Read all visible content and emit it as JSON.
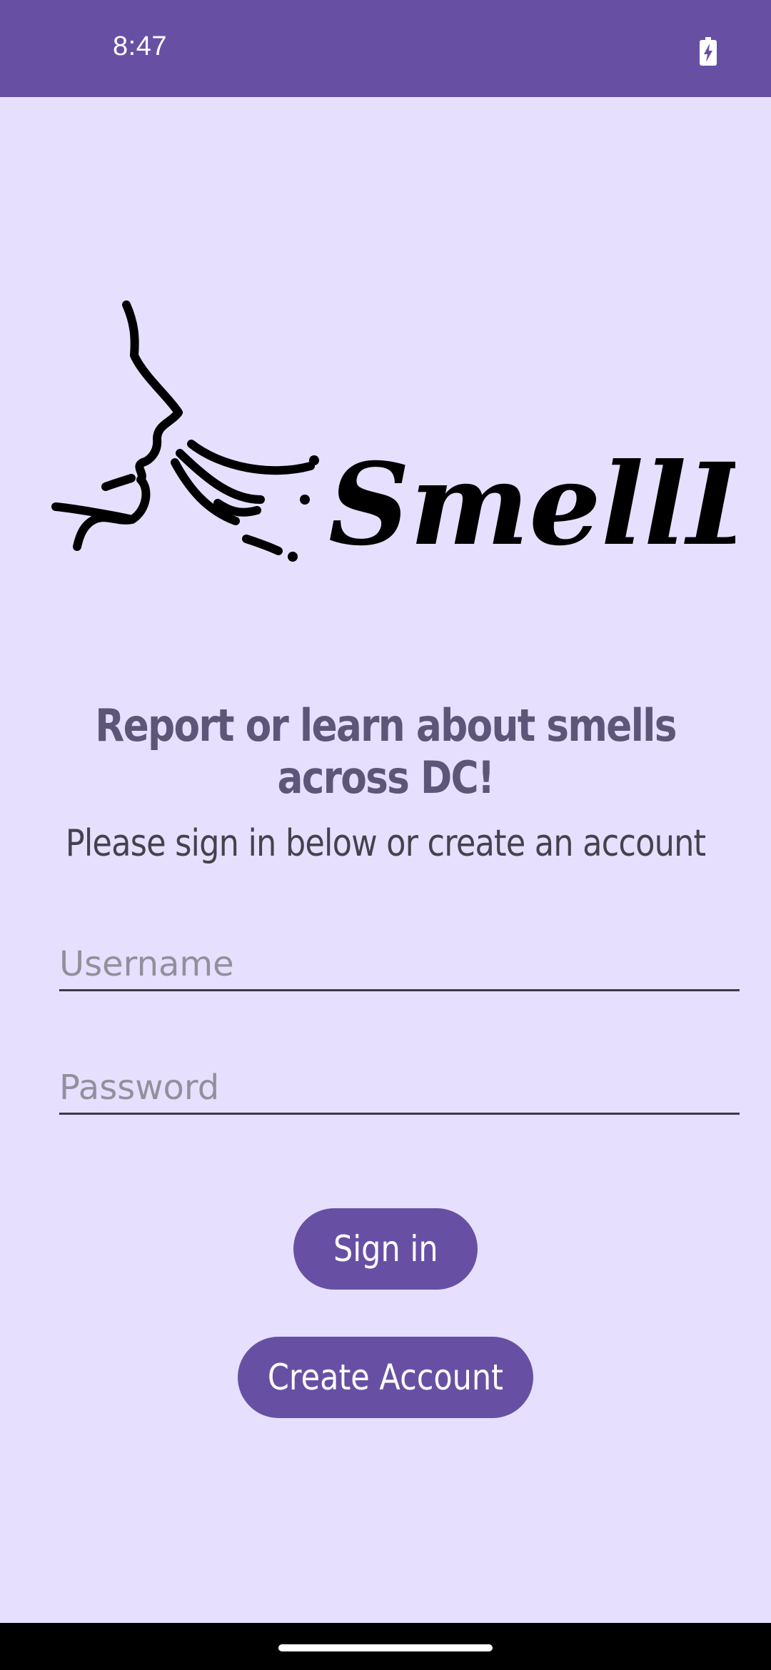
{
  "status_bar": {
    "time": "8:47",
    "battery_icon": "battery-charging-icon"
  },
  "logo": {
    "text": "SmellDC",
    "icon": "face-smelling-icon"
  },
  "tagline": "Report or learn about smells across DC!",
  "subtitle": "Please sign in below or create an account",
  "form": {
    "username": {
      "value": "",
      "placeholder": "Username"
    },
    "password": {
      "value": "",
      "placeholder": "Password"
    }
  },
  "buttons": {
    "sign_in": "Sign in",
    "create_account": "Create Account"
  },
  "colors": {
    "primary": "#6750A4",
    "background": "#E6E0FE",
    "tagline": "#5D5678",
    "text": "#45424E"
  }
}
